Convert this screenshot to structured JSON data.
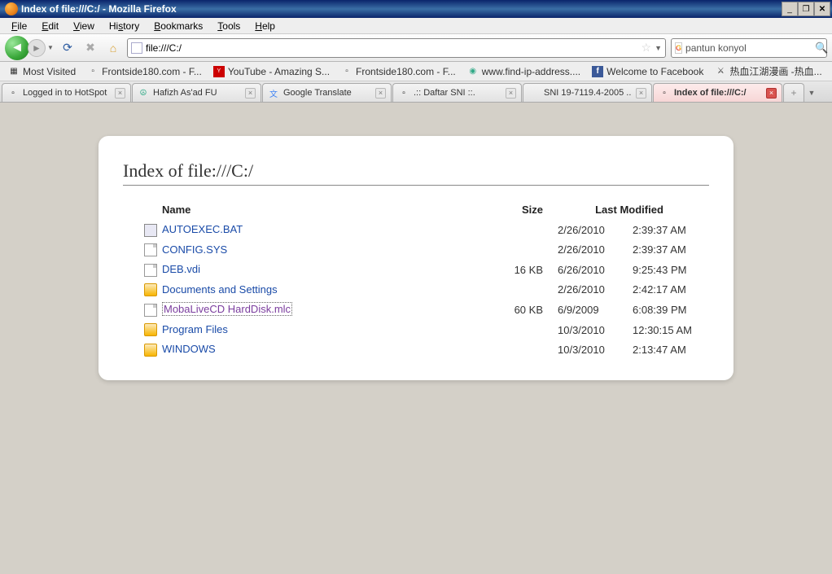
{
  "window": {
    "title": "Index of file:///C:/ - Mozilla Firefox"
  },
  "menu": {
    "file": "File",
    "edit": "Edit",
    "view": "View",
    "history": "History",
    "bookmarks": "Bookmarks",
    "tools": "Tools",
    "help": "Help"
  },
  "url": "file:///C:/",
  "search": {
    "value": "pantun konyol"
  },
  "bookmarks": [
    {
      "label": "Most Visited",
      "icon": "most"
    },
    {
      "label": "Frontside180.com - F...",
      "icon": "page"
    },
    {
      "label": "YouTube - Amazing S...",
      "icon": "yt"
    },
    {
      "label": "Frontside180.com - F...",
      "icon": "page"
    },
    {
      "label": "www.find-ip-address....",
      "icon": "fip"
    },
    {
      "label": "Welcome to Facebook",
      "icon": "fb"
    },
    {
      "label": "热血江湖漫画 -热血...",
      "icon": "cn"
    }
  ],
  "tabs": [
    {
      "label": "Logged in to HotSpot",
      "icon": "page",
      "active": false
    },
    {
      "label": "Hafizh As'ad FU",
      "icon": "peace",
      "active": false
    },
    {
      "label": "Google Translate",
      "icon": "gt",
      "active": false
    },
    {
      "label": ".:: Daftar SNI ::.",
      "icon": "page",
      "active": false
    },
    {
      "label": "SNI 19-7119.4-2005 ...",
      "icon": "goog",
      "active": false
    },
    {
      "label": "Index of file:///C:/",
      "icon": "page",
      "active": true
    }
  ],
  "page": {
    "heading": "Index of file:///C:/",
    "columns": {
      "name": "Name",
      "size": "Size",
      "modified": "Last Modified"
    },
    "rows": [
      {
        "name": "AUTOEXEC.BAT",
        "type": "bat",
        "size": "",
        "date": "2/26/2010",
        "time": "2:39:37 AM"
      },
      {
        "name": "CONFIG.SYS",
        "type": "file",
        "size": "",
        "date": "2/26/2010",
        "time": "2:39:37 AM"
      },
      {
        "name": "DEB.vdi",
        "type": "file",
        "size": "16 KB",
        "date": "6/26/2010",
        "time": "9:25:43 PM"
      },
      {
        "name": "Documents and Settings",
        "type": "folder",
        "size": "",
        "date": "2/26/2010",
        "time": "2:42:17 AM"
      },
      {
        "name": "MobaLiveCD HardDisk.mlc",
        "type": "file",
        "size": "60 KB",
        "date": "6/9/2009",
        "time": "6:08:39 PM",
        "visited": true,
        "selected": true
      },
      {
        "name": "Program Files",
        "type": "folder",
        "size": "",
        "date": "10/3/2010",
        "time": "12:30:15 AM"
      },
      {
        "name": "WINDOWS",
        "type": "folder",
        "size": "",
        "date": "10/3/2010",
        "time": "2:13:47 AM"
      }
    ]
  }
}
